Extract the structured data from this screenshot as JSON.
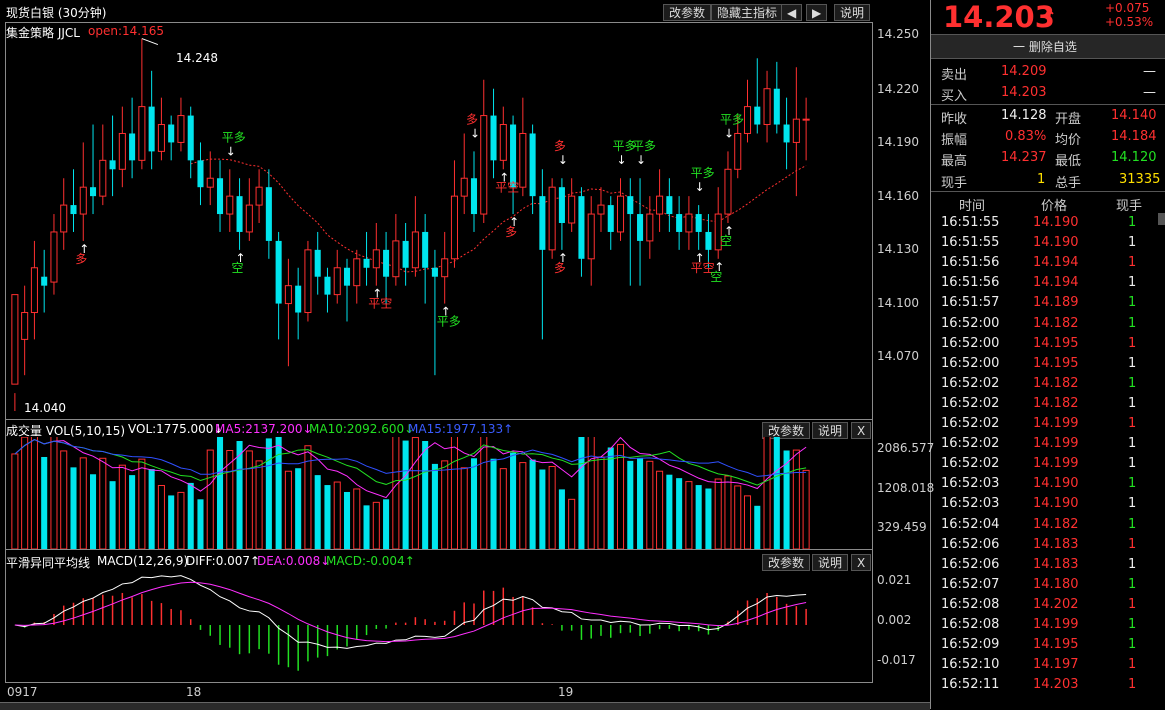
{
  "window": {
    "title": "现货白银 (30分钟)"
  },
  "toolbar": {
    "modify": "改参数",
    "hide_indicators": "隐藏主指标",
    "left": "◀",
    "right": "▶",
    "help": "说明"
  },
  "main": {
    "strategy": "集金策略 JJCL",
    "open_label": "open:14.165",
    "peak_label": "14.248",
    "low_label": "14.040",
    "y_ticks": [
      "14.250",
      "14.220",
      "14.190",
      "14.160",
      "14.130",
      "14.100",
      "14.070"
    ],
    "signals": [
      "平多",
      "多",
      "平空",
      "空",
      "多",
      "平多",
      "平多",
      "多",
      "平空",
      "多",
      "平多",
      "多",
      "平空",
      "空",
      "平多",
      "平多",
      "空"
    ]
  },
  "volume": {
    "title": "成交量 VOL(5,10,15)",
    "vol": "VOL:1775.000↓",
    "ma5": "MA5:2137.200↓",
    "ma10": "MA10:2092.600↓",
    "ma15": "MA15:1977.133↑",
    "y_ticks": [
      "2086.577",
      "1208.018",
      "329.459"
    ],
    "modify": "改参数",
    "help": "说明",
    "close": "X"
  },
  "macd": {
    "title": "平滑异同平均线",
    "params": "MACD(12,26,9)",
    "diff": "DIFF:0.007↑",
    "dea": "DEA:0.008↓",
    "macd": "MACD:-0.004↑",
    "y_ticks": [
      "0.021",
      "0.002",
      "-0.017"
    ],
    "modify": "改参数",
    "help": "说明",
    "close": "X"
  },
  "x_axis": {
    "labels": [
      "0917",
      "18",
      "19"
    ]
  },
  "colors": {
    "up": "#ff3030",
    "down": "#00e5ee",
    "green": "#22e022",
    "diff": "#ffffff",
    "dea": "#ff30ff",
    "ma10": "#22e022",
    "ma15": "#3050ff"
  },
  "quote": {
    "price": "14.203",
    "arrow": "↑",
    "change": "+0.075",
    "change_pct": "+0.53%",
    "watchlist_btn": "一 删除自选",
    "sell_label": "卖出",
    "sell_price": "14.209",
    "sell_vol": "—",
    "buy_label": "买入",
    "buy_price": "14.203",
    "buy_vol": "—",
    "prev_close_label": "昨收",
    "prev_close": "14.128",
    "open_label": "开盘",
    "open": "14.140",
    "amplitude_label": "振幅",
    "amplitude": "0.83%",
    "avg_label": "均价",
    "avg": "14.184",
    "high_label": "最高",
    "high": "14.237",
    "low_label": "最低",
    "low": "14.120",
    "cur_vol_label": "现手",
    "cur_vol": "1",
    "total_vol_label": "总手",
    "total_vol": "31335"
  },
  "ticks": {
    "headers": [
      "时间",
      "价格",
      "现手"
    ],
    "rows": [
      {
        "time": "16:51:55",
        "price": "14.190",
        "vol": "1",
        "pc": "red",
        "vc": "green"
      },
      {
        "time": "16:51:55",
        "price": "14.190",
        "vol": "1",
        "pc": "red",
        "vc": "white"
      },
      {
        "time": "16:51:56",
        "price": "14.194",
        "vol": "1",
        "pc": "red",
        "vc": "red"
      },
      {
        "time": "16:51:56",
        "price": "14.194",
        "vol": "1",
        "pc": "red",
        "vc": "white"
      },
      {
        "time": "16:51:57",
        "price": "14.189",
        "vol": "1",
        "pc": "red",
        "vc": "green"
      },
      {
        "time": "16:52:00",
        "price": "14.182",
        "vol": "1",
        "pc": "red",
        "vc": "green"
      },
      {
        "time": "16:52:00",
        "price": "14.195",
        "vol": "1",
        "pc": "red",
        "vc": "red"
      },
      {
        "time": "16:52:00",
        "price": "14.195",
        "vol": "1",
        "pc": "red",
        "vc": "white"
      },
      {
        "time": "16:52:02",
        "price": "14.182",
        "vol": "1",
        "pc": "red",
        "vc": "green"
      },
      {
        "time": "16:52:02",
        "price": "14.182",
        "vol": "1",
        "pc": "red",
        "vc": "white"
      },
      {
        "time": "16:52:02",
        "price": "14.199",
        "vol": "1",
        "pc": "red",
        "vc": "red"
      },
      {
        "time": "16:52:02",
        "price": "14.199",
        "vol": "1",
        "pc": "red",
        "vc": "white"
      },
      {
        "time": "16:52:02",
        "price": "14.199",
        "vol": "1",
        "pc": "red",
        "vc": "white"
      },
      {
        "time": "16:52:03",
        "price": "14.190",
        "vol": "1",
        "pc": "red",
        "vc": "green"
      },
      {
        "time": "16:52:03",
        "price": "14.190",
        "vol": "1",
        "pc": "red",
        "vc": "white"
      },
      {
        "time": "16:52:04",
        "price": "14.182",
        "vol": "1",
        "pc": "red",
        "vc": "green"
      },
      {
        "time": "16:52:06",
        "price": "14.183",
        "vol": "1",
        "pc": "red",
        "vc": "red"
      },
      {
        "time": "16:52:06",
        "price": "14.183",
        "vol": "1",
        "pc": "red",
        "vc": "white"
      },
      {
        "time": "16:52:07",
        "price": "14.180",
        "vol": "1",
        "pc": "red",
        "vc": "green"
      },
      {
        "time": "16:52:08",
        "price": "14.202",
        "vol": "1",
        "pc": "red",
        "vc": "red"
      },
      {
        "time": "16:52:08",
        "price": "14.199",
        "vol": "1",
        "pc": "red",
        "vc": "green"
      },
      {
        "time": "16:52:09",
        "price": "14.195",
        "vol": "1",
        "pc": "red",
        "vc": "green"
      },
      {
        "time": "16:52:10",
        "price": "14.197",
        "vol": "1",
        "pc": "red",
        "vc": "red"
      },
      {
        "time": "16:52:11",
        "price": "14.203",
        "vol": "1",
        "pc": "red",
        "vc": "red"
      }
    ]
  },
  "chart_data": {
    "type": "candlestick",
    "title": "现货白银 (30分钟)",
    "ylim": [
      14.04,
      14.25
    ],
    "x_labels": [
      "0917",
      "18",
      "19"
    ],
    "candles": [
      [
        14.055,
        14.105,
        14.05,
        14.04
      ],
      [
        14.08,
        14.095,
        14.11,
        14.06
      ],
      [
        14.095,
        14.12,
        14.135,
        14.08
      ],
      [
        14.115,
        14.11,
        14.13,
        14.095
      ],
      [
        14.112,
        14.14,
        14.15,
        14.105
      ],
      [
        14.14,
        14.155,
        14.17,
        14.13
      ],
      [
        14.155,
        14.15,
        14.175,
        14.14
      ],
      [
        14.15,
        14.165,
        14.19,
        14.135
      ],
      [
        14.165,
        14.16,
        14.2,
        14.15
      ],
      [
        14.16,
        14.18,
        14.2,
        14.155
      ],
      [
        14.18,
        14.175,
        14.205,
        14.16
      ],
      [
        14.175,
        14.195,
        14.21,
        14.165
      ],
      [
        14.195,
        14.18,
        14.215,
        14.17
      ],
      [
        14.18,
        14.21,
        14.248,
        14.175
      ],
      [
        14.21,
        14.185,
        14.23,
        14.175
      ],
      [
        14.185,
        14.2,
        14.215,
        14.18
      ],
      [
        14.2,
        14.19,
        14.205,
        14.18
      ],
      [
        14.19,
        14.205,
        14.215,
        14.185
      ],
      [
        14.205,
        14.18,
        14.21,
        14.17
      ],
      [
        14.18,
        14.165,
        14.19,
        14.155
      ],
      [
        14.165,
        14.17,
        14.185,
        14.155
      ],
      [
        14.17,
        14.15,
        14.18,
        14.14
      ],
      [
        14.15,
        14.16,
        14.175,
        14.14
      ],
      [
        14.16,
        14.14,
        14.17,
        14.13
      ],
      [
        14.14,
        14.155,
        14.17,
        14.135
      ],
      [
        14.155,
        14.165,
        14.175,
        14.145
      ],
      [
        14.165,
        14.135,
        14.175,
        14.125
      ],
      [
        14.135,
        14.1,
        14.14,
        14.08
      ],
      [
        14.1,
        14.11,
        14.125,
        14.065
      ],
      [
        14.11,
        14.095,
        14.12,
        14.08
      ],
      [
        14.095,
        14.13,
        14.135,
        14.09
      ],
      [
        14.13,
        14.115,
        14.14,
        14.105
      ],
      [
        14.115,
        14.105,
        14.12,
        14.095
      ],
      [
        14.105,
        14.12,
        14.13,
        14.1
      ],
      [
        14.12,
        14.11,
        14.125,
        14.09
      ],
      [
        14.11,
        14.125,
        14.13,
        14.1
      ],
      [
        14.125,
        14.12,
        14.14,
        14.11
      ],
      [
        14.12,
        14.13,
        14.145,
        14.11
      ],
      [
        14.13,
        14.115,
        14.14,
        14.1
      ],
      [
        14.115,
        14.135,
        14.15,
        14.11
      ],
      [
        14.135,
        14.12,
        14.145,
        14.11
      ],
      [
        14.12,
        14.14,
        14.16,
        14.115
      ],
      [
        14.14,
        14.12,
        14.15,
        14.1
      ],
      [
        14.12,
        14.115,
        14.13,
        14.06
      ],
      [
        14.115,
        14.125,
        14.14,
        14.1
      ],
      [
        14.125,
        14.16,
        14.18,
        14.12
      ],
      [
        14.16,
        14.17,
        14.195,
        14.15
      ],
      [
        14.17,
        14.15,
        14.185,
        14.14
      ],
      [
        14.15,
        14.205,
        14.225,
        14.145
      ],
      [
        14.205,
        14.18,
        14.22,
        14.17
      ],
      [
        14.18,
        14.2,
        14.21,
        14.175
      ],
      [
        14.2,
        14.165,
        14.205,
        14.15
      ],
      [
        14.165,
        14.195,
        14.215,
        14.16
      ],
      [
        14.195,
        14.16,
        14.2,
        14.15
      ],
      [
        14.16,
        14.13,
        14.175,
        14.08
      ],
      [
        14.13,
        14.165,
        14.17,
        14.125
      ],
      [
        14.165,
        14.145,
        14.17,
        14.13
      ],
      [
        14.145,
        14.16,
        14.17,
        14.14
      ],
      [
        14.16,
        14.125,
        14.165,
        14.115
      ],
      [
        14.125,
        14.15,
        14.16,
        14.11
      ],
      [
        14.15,
        14.155,
        14.165,
        14.14
      ],
      [
        14.155,
        14.14,
        14.16,
        14.13
      ],
      [
        14.14,
        14.16,
        14.17,
        14.135
      ],
      [
        14.16,
        14.15,
        14.17,
        14.11
      ],
      [
        14.15,
        14.135,
        14.17,
        14.11
      ],
      [
        14.135,
        14.15,
        14.16,
        14.125
      ],
      [
        14.15,
        14.16,
        14.175,
        14.14
      ],
      [
        14.16,
        14.15,
        14.17,
        14.14
      ],
      [
        14.15,
        14.14,
        14.16,
        14.13
      ],
      [
        14.14,
        14.15,
        14.16,
        14.13
      ],
      [
        14.15,
        14.14,
        14.155,
        14.13
      ],
      [
        14.14,
        14.13,
        14.15,
        14.12
      ],
      [
        14.13,
        14.15,
        14.165,
        14.125
      ],
      [
        14.15,
        14.175,
        14.185,
        14.145
      ],
      [
        14.175,
        14.195,
        14.205,
        14.17
      ],
      [
        14.195,
        14.21,
        14.225,
        14.19
      ],
      [
        14.21,
        14.2,
        14.237,
        14.195
      ],
      [
        14.2,
        14.22,
        14.23,
        14.19
      ],
      [
        14.22,
        14.2,
        14.235,
        14.195
      ],
      [
        14.2,
        14.19,
        14.215,
        14.175
      ],
      [
        14.19,
        14.203,
        14.232,
        14.16
      ],
      [
        14.203,
        14.203,
        14.215,
        14.18
      ]
    ],
    "volume_ylim": [
      0,
      2500
    ],
    "macd_ylim": [
      -0.025,
      0.025
    ]
  }
}
